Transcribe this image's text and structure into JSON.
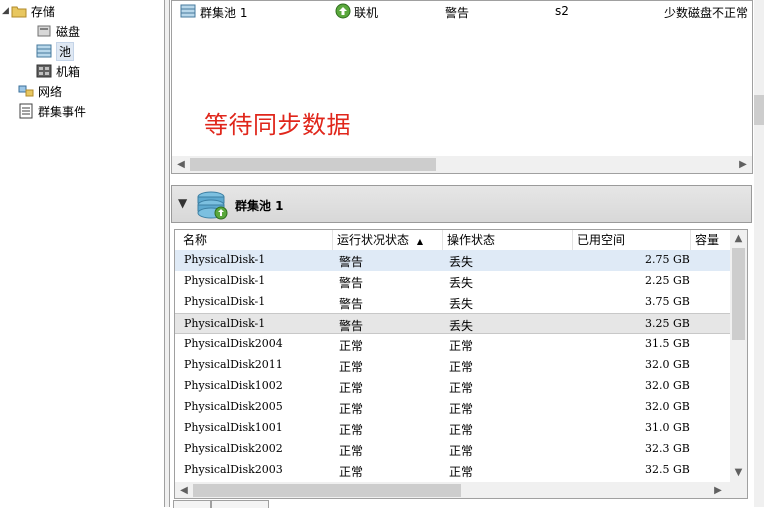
{
  "tree": {
    "storage": "存储",
    "disks": "磁盘",
    "pools": "池",
    "enclosures": "机箱",
    "network": "网络",
    "cluster_events": "群集事件"
  },
  "pool_row": {
    "name": "群集池 1",
    "status": "联机",
    "health": "警告",
    "owner": "s2",
    "info": "少数磁盘不正常"
  },
  "waiting_text": "等待同步数据",
  "detail": {
    "title": "群集池 1"
  },
  "grid": {
    "columns": [
      "名称",
      "运行状况状态",
      "操作状态",
      "已用空间",
      "容量"
    ],
    "rows": [
      {
        "name": "PhysicalDisk-1",
        "health": "警告",
        "op": "丢失",
        "used": "2.75 GB"
      },
      {
        "name": "PhysicalDisk-1",
        "health": "警告",
        "op": "丢失",
        "used": "2.25 GB"
      },
      {
        "name": "PhysicalDisk-1",
        "health": "警告",
        "op": "丢失",
        "used": "3.75 GB"
      },
      {
        "name": "PhysicalDisk-1",
        "health": "警告",
        "op": "丢失",
        "used": "3.25 GB"
      },
      {
        "name": "PhysicalDisk2004",
        "health": "正常",
        "op": "正常",
        "used": "31.5 GB"
      },
      {
        "name": "PhysicalDisk2011",
        "health": "正常",
        "op": "正常",
        "used": "32.0 GB"
      },
      {
        "name": "PhysicalDisk1002",
        "health": "正常",
        "op": "正常",
        "used": "32.0 GB"
      },
      {
        "name": "PhysicalDisk2005",
        "health": "正常",
        "op": "正常",
        "used": "32.0 GB"
      },
      {
        "name": "PhysicalDisk1001",
        "health": "正常",
        "op": "正常",
        "used": "31.0 GB"
      },
      {
        "name": "PhysicalDisk2002",
        "health": "正常",
        "op": "正常",
        "used": "32.3 GB"
      },
      {
        "name": "PhysicalDisk2003",
        "health": "正常",
        "op": "正常",
        "used": "32.5 GB"
      }
    ]
  },
  "colors": {
    "waiting": "#e0261b",
    "selection": "#dfeaf6"
  },
  "icons": {
    "storage": "folder-icon",
    "disks": "disk-icon",
    "pools": "pool-icon",
    "enclosures": "enclosure-icon",
    "network": "network-icon",
    "events": "event-log-icon",
    "status": "online-arrow-icon",
    "pool_large": "pool-stack-icon"
  }
}
